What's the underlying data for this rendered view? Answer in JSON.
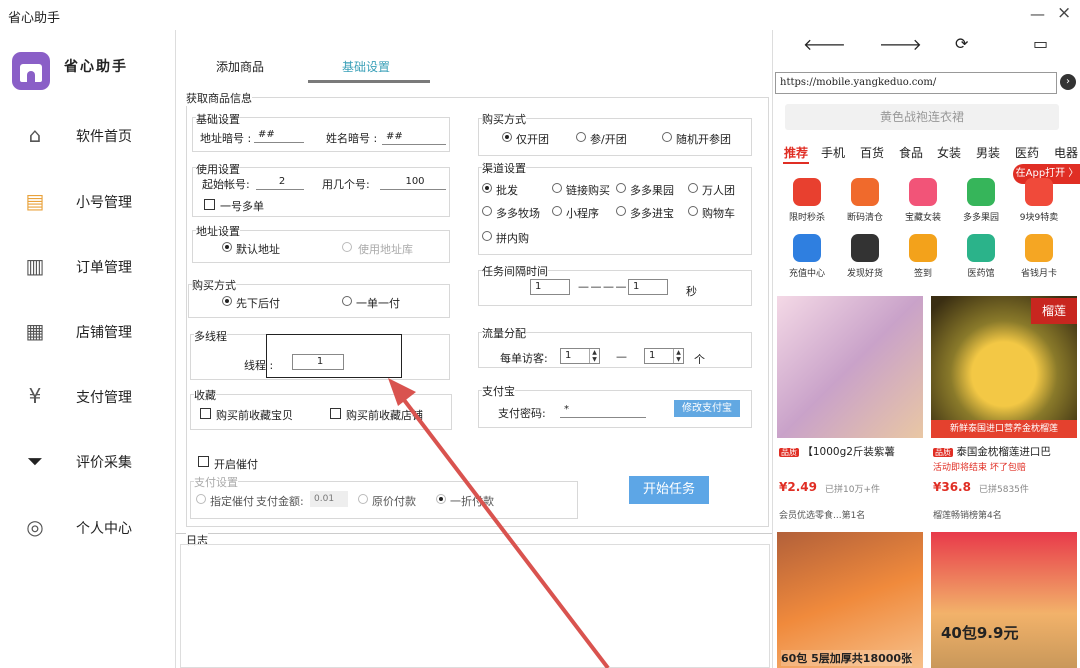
{
  "window": {
    "title": "省心助手",
    "min": "—",
    "close": "×"
  },
  "sidebar": {
    "logo_text": "省心助手",
    "items": [
      {
        "label": "软件首页",
        "icon": "home-icon"
      },
      {
        "label": "小号管理",
        "icon": "accounts-icon"
      },
      {
        "label": "订单管理",
        "icon": "orders-icon"
      },
      {
        "label": "店铺管理",
        "icon": "store-icon"
      },
      {
        "label": "支付管理",
        "icon": "payment-icon"
      },
      {
        "label": "评价采集",
        "icon": "filter-icon"
      },
      {
        "label": "个人中心",
        "icon": "user-icon"
      }
    ]
  },
  "tabs": {
    "add_product": "添加商品",
    "basic_settings": "基础设置"
  },
  "form": {
    "fetch_group": "获取商品信息",
    "basic": {
      "title": "基础设置",
      "addr_code_label": "地址暗号 :",
      "addr_code_value": "##",
      "name_code_label": "姓名暗号 :",
      "name_code_value": "##"
    },
    "usage": {
      "title": "使用设置",
      "start_label": "起始帐号:",
      "start_value": "2",
      "count_label": "用几个号:",
      "count_value": "100",
      "multi_order": "一号多单"
    },
    "address": {
      "title": "地址设置",
      "default": "默认地址",
      "library": "使用地址库"
    },
    "buy_mode": {
      "title": "购买方式",
      "first_then_pay": "先下后付",
      "one_by_one": "一单一付"
    },
    "threads": {
      "title": "多线程",
      "label": "线程 :",
      "value": "1"
    },
    "favorite": {
      "title": "收藏",
      "fav_item": "购买前收藏宝贝",
      "fav_store": "购买前收藏店铺"
    },
    "purchase_type": {
      "title": "购买方式",
      "only_group": "仅开团",
      "join_group": "参/开团",
      "random": "随机开参团"
    },
    "channel": {
      "title": "渠道设置",
      "options": [
        "批发",
        "链接购买",
        "多多果园",
        "万人团",
        "多多牧场",
        "小程序",
        "多多进宝",
        "购物车",
        "拼内购"
      ]
    },
    "interval": {
      "title": "任务间隔时间",
      "from": "1",
      "dash": "— — — —",
      "to": "1",
      "unit": "秒"
    },
    "traffic": {
      "title": "流量分配",
      "label": "每单访客:",
      "from": "1",
      "dash": "—",
      "to": "1",
      "unit": "个"
    },
    "alipay": {
      "title": "支付宝",
      "label": "支付密码:",
      "value": "*",
      "button": "修改支付宝"
    },
    "urge": {
      "enable": "开启催付",
      "title": "支付设置",
      "fixed": "指定催付",
      "amount_label": "支付金额:",
      "amount_value": "0.01",
      "original": "原价付款",
      "discount": "一折付款"
    },
    "start_button": "开始任务",
    "log_title": "日志"
  },
  "browser": {
    "back": "🡐",
    "forward": "🡒",
    "refresh": "⟳",
    "window": "▭",
    "url": "https://mobile.yangkeduo.com/",
    "go": "›",
    "search_placeholder": "黄色战袍连衣裙",
    "categories": [
      "推荐",
      "手机",
      "百货",
      "食品",
      "女装",
      "男装",
      "医药",
      "电器"
    ],
    "open_app": "在App打开 〉",
    "icons": [
      {
        "label": "限时秒杀",
        "color": "#e8402f"
      },
      {
        "label": "断码清仓",
        "color": "#f06a2c"
      },
      {
        "label": "宝藏女装",
        "color": "#f25478"
      },
      {
        "label": "多多果园",
        "color": "#36b55a"
      },
      {
        "label": "9块9特卖",
        "color": "#f04a3a"
      },
      {
        "label": "充值中心",
        "color": "#2f7fe0"
      },
      {
        "label": "发现好货",
        "color": "#333333"
      },
      {
        "label": "签到",
        "color": "#f3a21b"
      },
      {
        "label": "医药馆",
        "color": "#2bb38a"
      },
      {
        "label": "省钱月卡",
        "color": "#f5a623"
      }
    ],
    "products": [
      {
        "title": "【1000g2斤装紫薯",
        "price": "¥2.49",
        "sold": "已拼10万+件",
        "shop": "会员优选零食...第1名"
      },
      {
        "title": "泰国金枕榴莲进口巴",
        "banner": "榴莲",
        "strip": "新鲜泰国进口营养金枕榴莲",
        "sub": "活动即将结束  坏了包赔",
        "price": "¥36.8",
        "sold": "已拼5835件",
        "shop": "榴莲畅销榜第4名"
      },
      {
        "caption": "60包 5层加厚共18000张"
      },
      {
        "caption": "40包9.9元"
      }
    ],
    "tag": "品质"
  }
}
